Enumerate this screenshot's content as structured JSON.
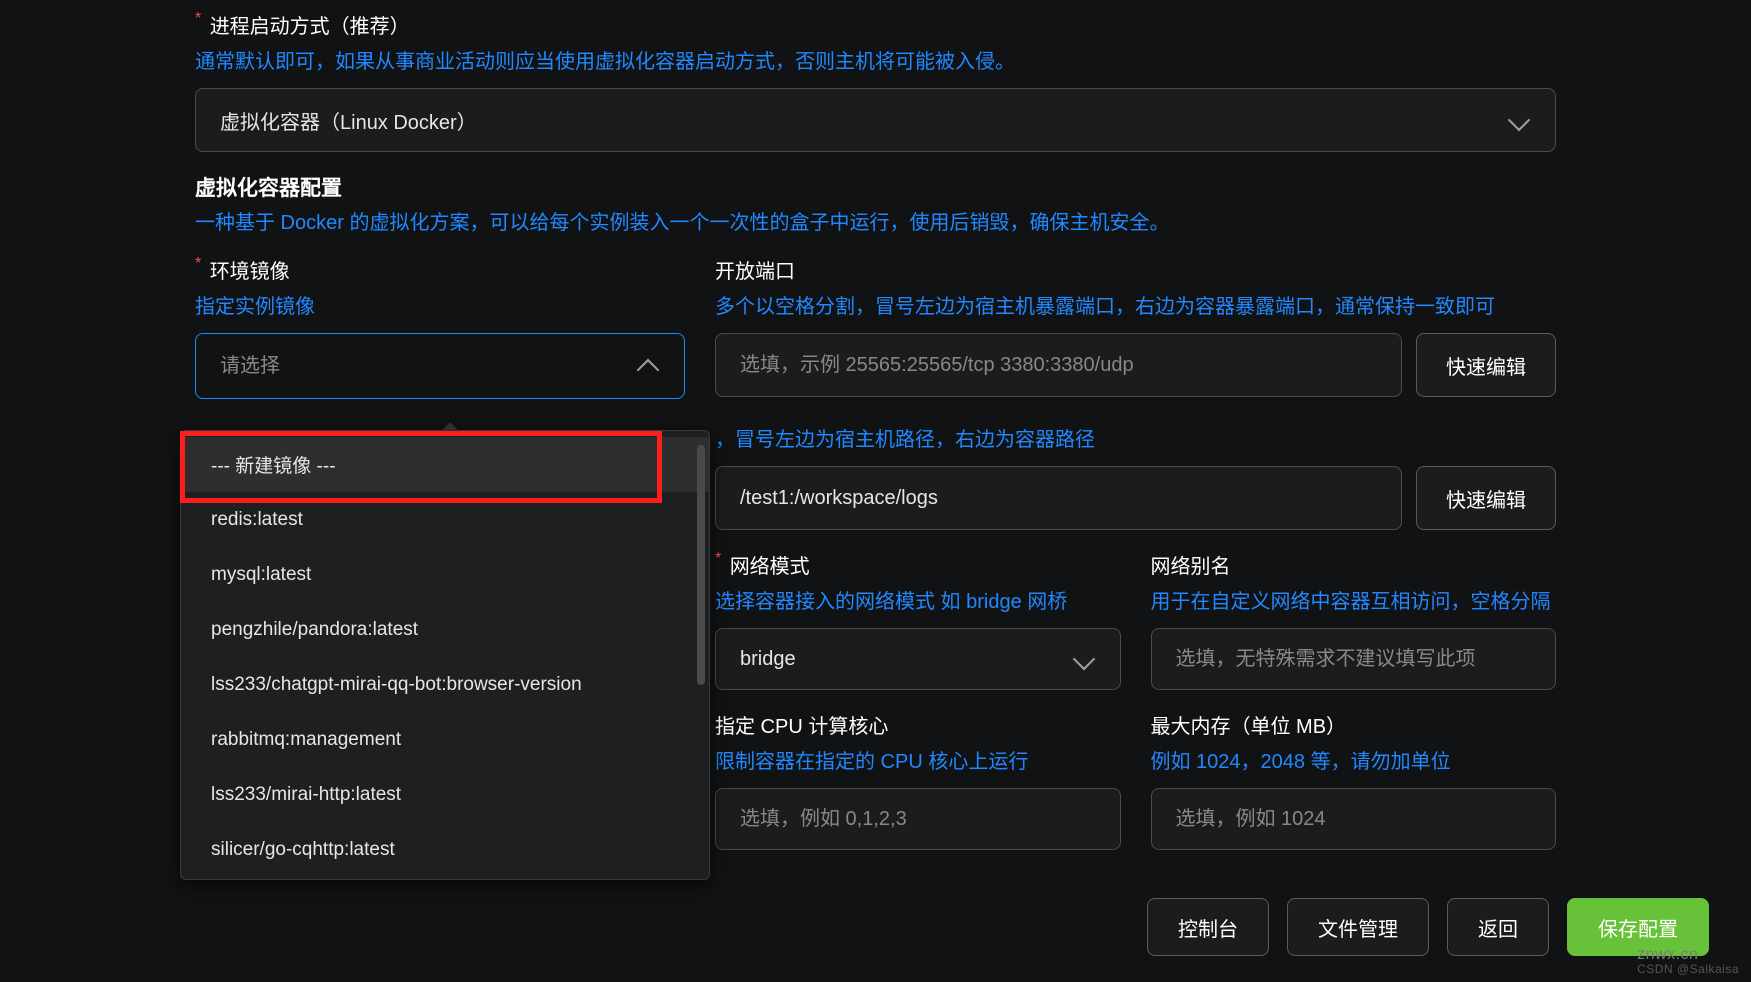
{
  "startup": {
    "label": "进程启动方式（推荐）",
    "desc": "通常默认即可，如果从事商业活动则应当使用虚拟化容器启动方式，否则主机将可能被入侵。",
    "value": "虚拟化容器（Linux Docker）"
  },
  "container_config": {
    "title": "虚拟化容器配置",
    "desc": "一种基于 Docker 的虚拟化方案，可以给每个实例装入一个一次性的盒子中运行，使用后销毁，确保主机安全。"
  },
  "env_image": {
    "label": "环境镜像",
    "desc": "指定实例镜像",
    "placeholder": "请选择",
    "options": [
      "--- 新建镜像 ---",
      "redis:latest",
      "mysql:latest",
      "pengzhile/pandora:latest",
      "lss233/chatgpt-mirai-qq-bot:browser-version",
      "rabbitmq:management",
      "lss233/mirai-http:latest",
      "silicer/go-cqhttp:latest"
    ]
  },
  "open_port": {
    "label": "开放端口",
    "desc": "多个以空格分割，冒号左边为宿主机暴露端口，右边为容器暴露端口，通常保持一致即可",
    "placeholder": "选填，示例 25565:25565/tcp 3380:3380/udp",
    "button": "快速编辑"
  },
  "extra_mount": {
    "desc": "，冒号左边为宿主机路径，右边为容器路径",
    "value": "/test1:/workspace/logs",
    "button": "快速编辑"
  },
  "network_mode": {
    "label": "网络模式",
    "desc": "选择容器接入的网络模式 如 bridge 网桥",
    "value": "bridge"
  },
  "network_alias": {
    "label": "网络别名",
    "desc": "用于在自定义网络中容器互相访问，空格分隔",
    "placeholder": "选填，无特殊需求不建议填写此项"
  },
  "cpu_core": {
    "label": "指定 CPU 计算核心",
    "desc": "限制容器在指定的 CPU 核心上运行",
    "placeholder": "选填，例如 0,1,2,3"
  },
  "max_memory": {
    "label": "最大内存（单位 MB）",
    "desc": "例如 1024，2048 等，请勿加单位",
    "placeholder": "选填，例如 1024"
  },
  "footer": {
    "console": "控制台",
    "file_manage": "文件管理",
    "back": "返回",
    "save": "保存配置"
  },
  "watermark": {
    "main": "znwx.cn",
    "sub": "CSDN @Salkaisa"
  }
}
